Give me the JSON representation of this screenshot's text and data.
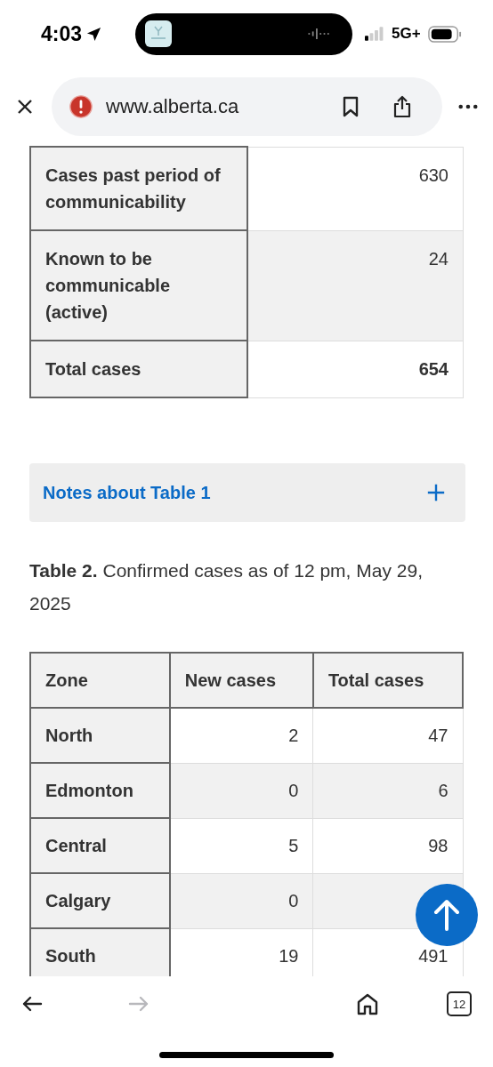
{
  "status_bar": {
    "time": "4:03",
    "network": "5G+"
  },
  "browser": {
    "url": "www.alberta.ca"
  },
  "table_1": {
    "rows": [
      {
        "label": "Cases past period of communicability",
        "value": "630",
        "kind": "count"
      },
      {
        "label": "Known to be communicable (active)",
        "value": "24",
        "kind": "count"
      },
      {
        "label": "Total cases",
        "value": "654",
        "kind": "total"
      }
    ]
  },
  "notes": {
    "title": "Notes about Table 1",
    "expanded": false
  },
  "table_2": {
    "caption": "**Table 2.** Confirmed cases as of 12 pm, May 29, 2025",
    "columns": [
      "Zone",
      "New cases",
      "Total cases"
    ],
    "rows": [
      {
        "cells": [
          "North",
          "2",
          "47"
        ]
      },
      {
        "cells": [
          "Edmonton",
          "0",
          "6"
        ]
      },
      {
        "cells": [
          "Central",
          "5",
          "98"
        ]
      },
      {
        "cells": [
          "Calgary",
          "0"
        ]
      },
      {
        "cells": [
          "South",
          "19",
          "491"
        ]
      }
    ]
  },
  "toolbar": {
    "back": {
      "disabled": false
    },
    "forward": {
      "disabled": true
    },
    "tab_count": "12"
  }
}
